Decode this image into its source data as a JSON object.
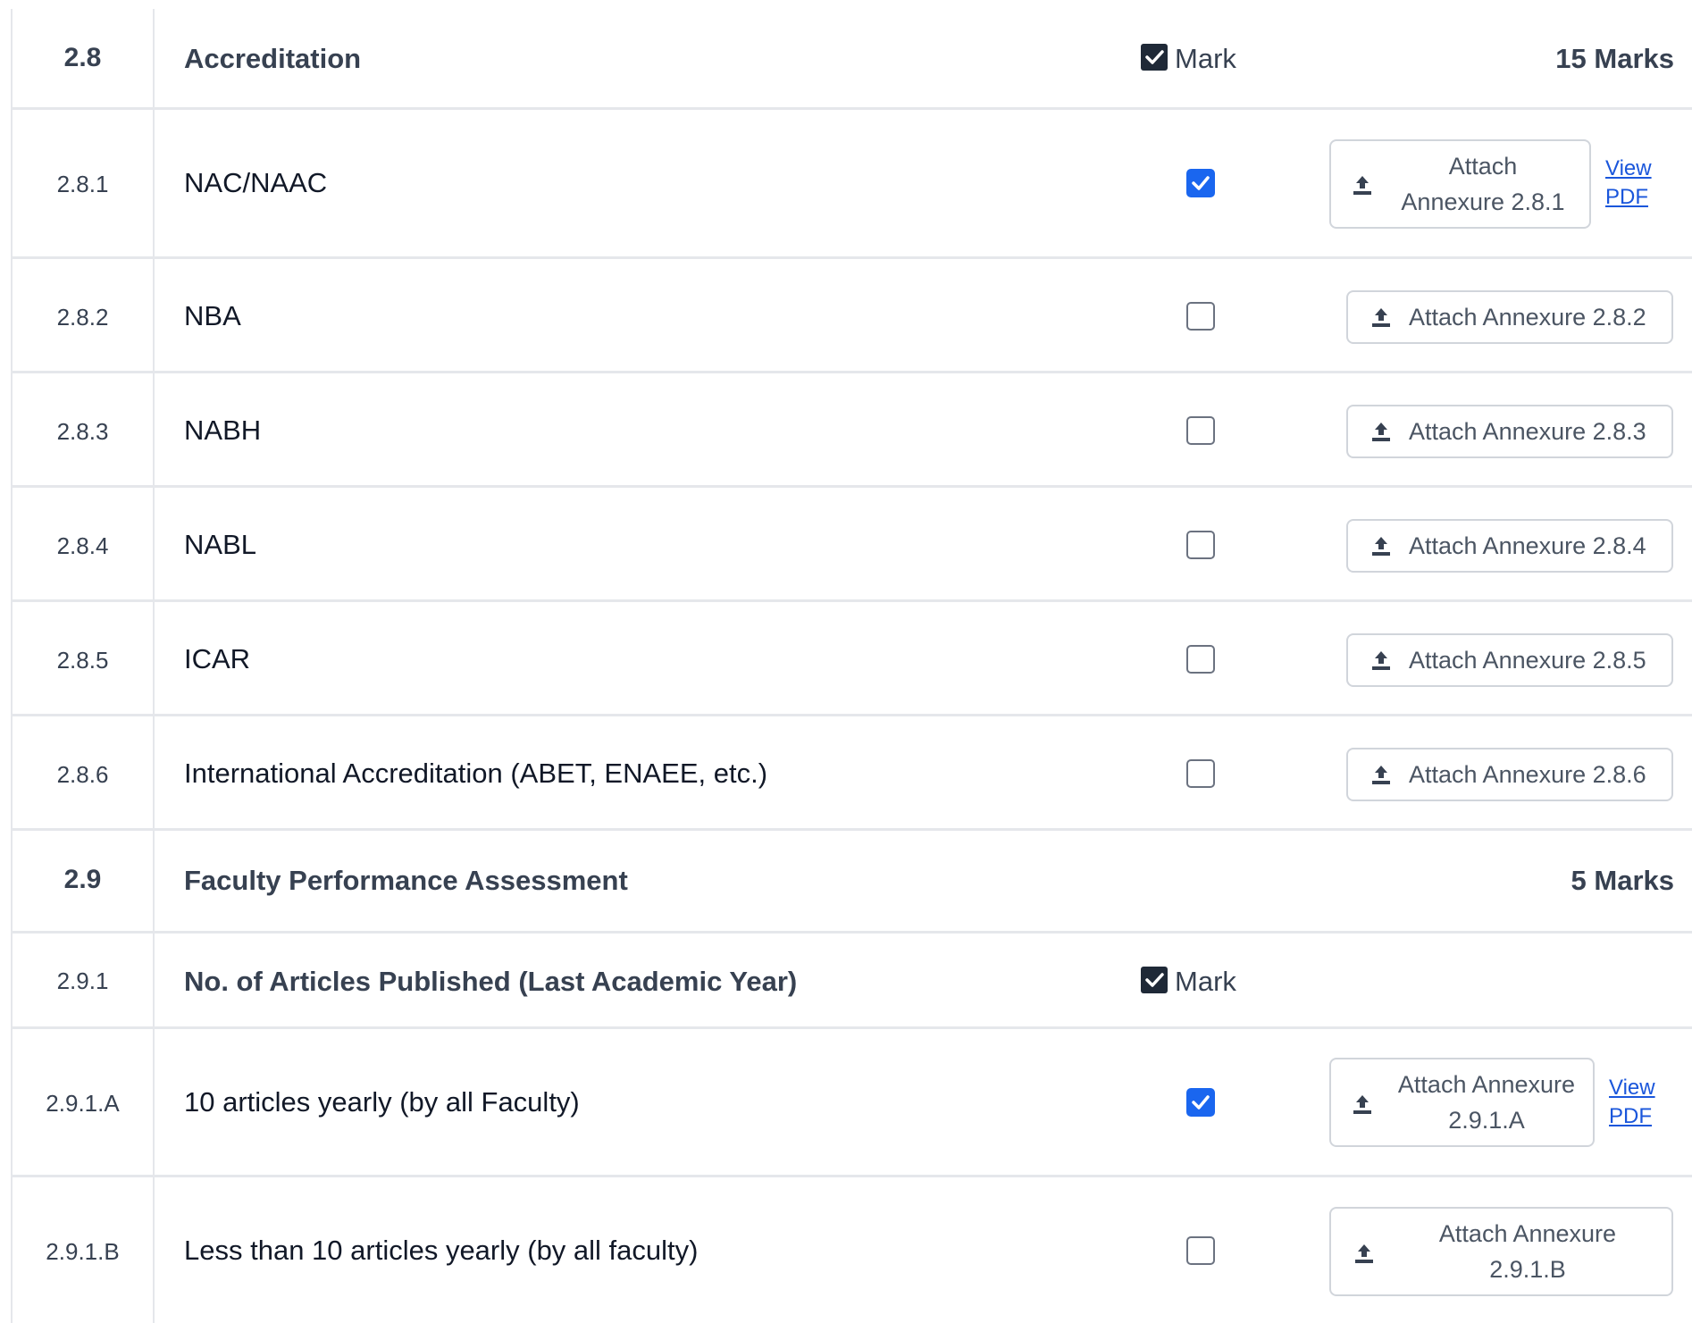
{
  "sections": [
    {
      "number": "2.8",
      "title": "Accreditation",
      "mark_label": "Mark",
      "marks": "15 Marks"
    },
    {
      "number": "2.9",
      "title": "Faculty Performance Assessment",
      "marks": "5 Marks"
    }
  ],
  "subsection": {
    "number": "2.9.1",
    "title": "No. of Articles Published (Last Academic Year)",
    "mark_label": "Mark"
  },
  "rows": [
    {
      "number": "2.8.1",
      "label": "NAC/NAAC",
      "checked": true,
      "attach_line1": "Attach",
      "attach_line2": "Annexure 2.8.1",
      "view_line1": "View",
      "view_line2": "PDF"
    },
    {
      "number": "2.8.2",
      "label": "NBA",
      "checked": false,
      "attach": "Attach Annexure 2.8.2"
    },
    {
      "number": "2.8.3",
      "label": "NABH",
      "checked": false,
      "attach": "Attach Annexure 2.8.3"
    },
    {
      "number": "2.8.4",
      "label": "NABL",
      "checked": false,
      "attach": "Attach Annexure 2.8.4"
    },
    {
      "number": "2.8.5",
      "label": "ICAR",
      "checked": false,
      "attach": "Attach Annexure 2.8.5"
    },
    {
      "number": "2.8.6",
      "label": "International Accreditation (ABET, ENAEE, etc.)",
      "checked": false,
      "attach": "Attach Annexure 2.8.6"
    },
    {
      "number": "2.9.1.A",
      "label": "10 articles yearly (by all Faculty)",
      "checked": true,
      "attach_line1": "Attach Annexure",
      "attach_line2": "2.9.1.A",
      "view_line1": "View",
      "view_line2": "PDF"
    },
    {
      "number": "2.9.1.B",
      "label": "Less than 10 articles yearly (by all faculty)",
      "checked": false,
      "attach_line1": "Attach Annexure",
      "attach_line2": "2.9.1.B"
    }
  ]
}
